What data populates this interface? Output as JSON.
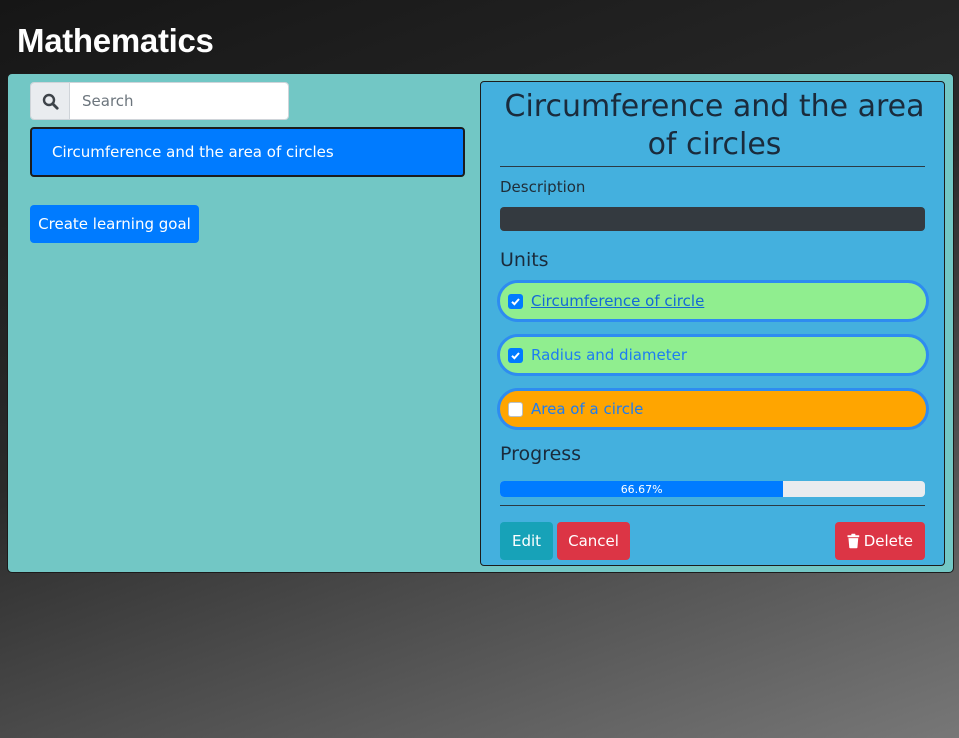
{
  "page": {
    "title": "Mathematics"
  },
  "sidebar": {
    "search": {
      "placeholder": "Search",
      "value": "",
      "icon": "search-icon"
    },
    "goals": [
      {
        "label": "Circumference and the area of circles",
        "selected": true
      }
    ],
    "create_button_label": "Create learning goal"
  },
  "detail": {
    "title": "Circumference and the area of circles",
    "description_label": "Description",
    "description_value": "",
    "units_heading": "Units",
    "units": [
      {
        "label": "Circumference of circle",
        "checked": true,
        "color": "#90ee8f"
      },
      {
        "label": "Radius and diameter",
        "checked": true,
        "color": "#90ee8f"
      },
      {
        "label": "Area of a circle",
        "checked": false,
        "color": "#ffa500"
      }
    ],
    "progress_heading": "Progress",
    "progress": {
      "label": "66.67%",
      "fraction": 0.6667
    },
    "buttons": {
      "edit": "Edit",
      "cancel": "Cancel",
      "delete": "Delete"
    }
  },
  "colors": {
    "panel": "#72c7c5",
    "card": "#44b0de",
    "primary": "#007bff",
    "info": "#17a2b8",
    "danger": "#dc3545"
  }
}
